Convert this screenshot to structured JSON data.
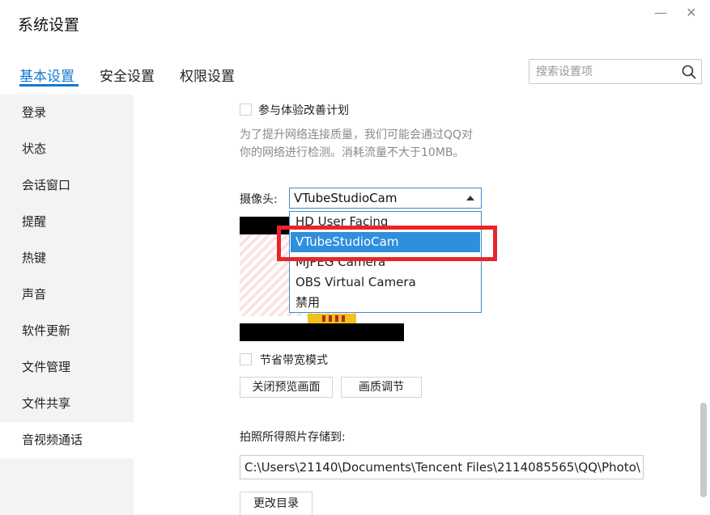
{
  "window": {
    "title": "系统设置",
    "minimize_glyph": "—",
    "close_glyph": "✕"
  },
  "tabs": [
    {
      "label": "基本设置",
      "active": true
    },
    {
      "label": "安全设置",
      "active": false
    },
    {
      "label": "权限设置",
      "active": false
    }
  ],
  "search": {
    "placeholder": "搜索设置项",
    "value": ""
  },
  "sidebar": {
    "items": [
      {
        "label": "登录"
      },
      {
        "label": "状态"
      },
      {
        "label": "会话窗口"
      },
      {
        "label": "提醒"
      },
      {
        "label": "热键"
      },
      {
        "label": "声音"
      },
      {
        "label": "软件更新"
      },
      {
        "label": "文件管理"
      },
      {
        "label": "文件共享"
      },
      {
        "label": "音视频通话",
        "active": true
      }
    ]
  },
  "main": {
    "experience_plan_label": "参与体验改善计划",
    "experience_plan_checked": false,
    "experience_hint_line1": "为了提升网络连接质量，我们可能会通过QQ对",
    "experience_hint_line2": "你的网络进行检测。消耗流量不大于10MB。",
    "camera_label": "摄像头:",
    "camera_selected": "VTubeStudioCam",
    "camera_options": [
      "HD User Facing",
      "VTubeStudioCam",
      "MJPEG Camera",
      "OBS Virtual Camera",
      "禁用"
    ],
    "bandwidth_label": "节省带宽模式",
    "bandwidth_checked": false,
    "close_preview_button": "关闭预览画面",
    "quality_button": "画质调节",
    "photo_save_label": "拍照所得照片存储到:",
    "photo_path": "C:\\Users\\21140\\Documents\\Tencent Files\\2114085565\\QQ\\Photo\\",
    "change_dir_button": "更改目录"
  },
  "colors": {
    "accent": "#1478d0",
    "selected_option": "#2f8fdd",
    "annotation_red": "#e8262a",
    "sidebar_bg": "#f3f3f3"
  }
}
